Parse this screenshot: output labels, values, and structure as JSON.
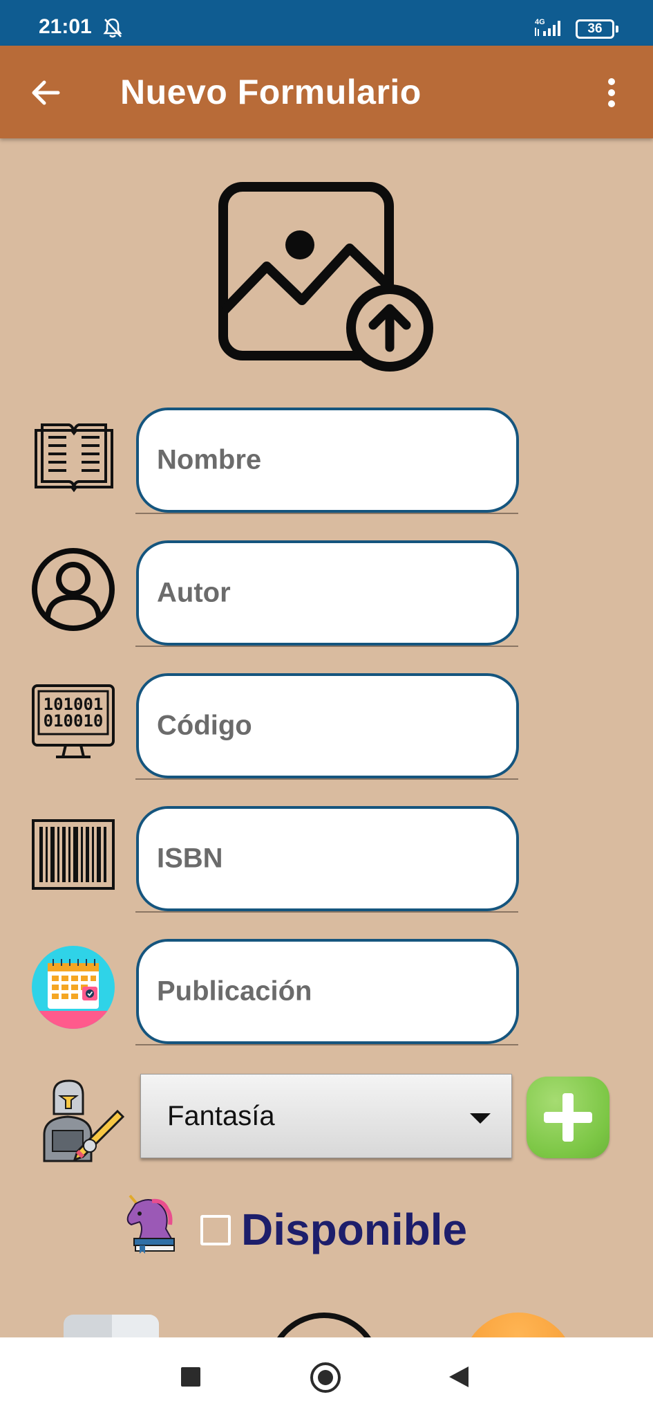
{
  "status_bar": {
    "time": "21:01",
    "network": "4G",
    "battery": "36"
  },
  "app_bar": {
    "title": "Nuevo Formulario"
  },
  "form": {
    "fields": [
      {
        "placeholder": "Nombre",
        "icon": "open-book-icon"
      },
      {
        "placeholder": "Autor",
        "icon": "user-profile-icon"
      },
      {
        "placeholder": "Código",
        "icon": "binary-code-monitor-icon"
      },
      {
        "placeholder": "ISBN",
        "icon": "barcode-icon"
      },
      {
        "placeholder": "Publicación",
        "icon": "calendar-icon"
      }
    ],
    "genre": {
      "selected": "Fantasía",
      "icon": "knight-writer-icon"
    },
    "available": {
      "label": "Disponible",
      "checked": false,
      "icon": "unicorn-book-icon"
    }
  },
  "colors": {
    "status_bar": "#0f5c91",
    "app_bar": "#b86b38",
    "background": "#d9bb9f",
    "field_border": "#15557e",
    "add_button": "#7bc644",
    "available_label": "#1d1e6b"
  }
}
